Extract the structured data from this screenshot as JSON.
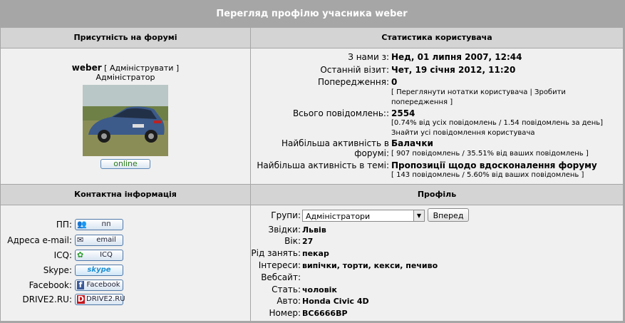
{
  "title": "Перегляд профілю учасника weber",
  "presence": {
    "header": "Присутність на форумі",
    "username": "weber",
    "admin_link": "[ Адмініструвати ]",
    "rank": "Адміністратор",
    "online": "online"
  },
  "stats": {
    "header": "Статистика користувача",
    "joined_label": "З нами з:",
    "joined_value": "Нед, 01 липня 2007, 12:44",
    "last_visit_label": "Останній візит:",
    "last_visit_value": "Чет, 19 січня 2012, 11:20",
    "warnings_label": "Попередження:",
    "warnings_value": "0",
    "notes_line1": "[ Переглянути нотатки користувача | Зробити",
    "notes_line2": "попередження ]",
    "posts_label": "Всього повідомлень::",
    "posts_value": "2554",
    "posts_detail": "[0.74% від усіх повідомлень / 1.54 повідомлень за день]",
    "posts_find": "Знайти усі повідомлення користувача",
    "active_forum_label": "Найбільша активність в форумі:",
    "active_forum_value": "Балачки",
    "active_forum_detail": "[ 907 повідомлень / 35.51% від ваших повідомлень ]",
    "active_topic_label": "Найбільша активність в темі:",
    "active_topic_value": "Пропозиції щодо вдосконалення форуму",
    "active_topic_detail": "[ 143 повідомлень / 5.60% від ваших повідомлень ]"
  },
  "contacts": {
    "header": "Контактна інформація",
    "pm_label": "ПП:",
    "pm_btn": "пп",
    "email_label": "Адреса e-mail:",
    "email_btn": "email",
    "icq_label": "ICQ:",
    "icq_btn": "ICQ",
    "skype_label": "Skype:",
    "skype_btn": "skype",
    "facebook_label": "Facebook:",
    "facebook_btn": "Facebook",
    "drive_label": "DRIVE2.RU:",
    "drive_btn": "DRIVE2.RU"
  },
  "profile": {
    "header": "Профіль",
    "groups_label": "Групи:",
    "groups_value": "Адміністратори",
    "go_button": "Вперед",
    "from_label": "Звідки:",
    "from_value": "Львів",
    "age_label": "Вік:",
    "age_value": "27",
    "occupation_label": "Рід занять:",
    "occupation_value": "пекар",
    "interests_label": "Інтереси:",
    "interests_value": "випічки, торти, кекси, печиво",
    "website_label": "Вебсайт:",
    "website_value": "",
    "gender_label": "Стать:",
    "gender_value": "чоловік",
    "car_label": "Авто:",
    "car_value": "Honda Civic 4D",
    "plate_label": "Номер:",
    "plate_value": "BC6666BP"
  },
  "colors": {
    "header_bg": "#a6a6a6",
    "section_bg": "#d4d4d4",
    "cell_bg": "#f0f0f0",
    "online": "#2a7a18"
  }
}
